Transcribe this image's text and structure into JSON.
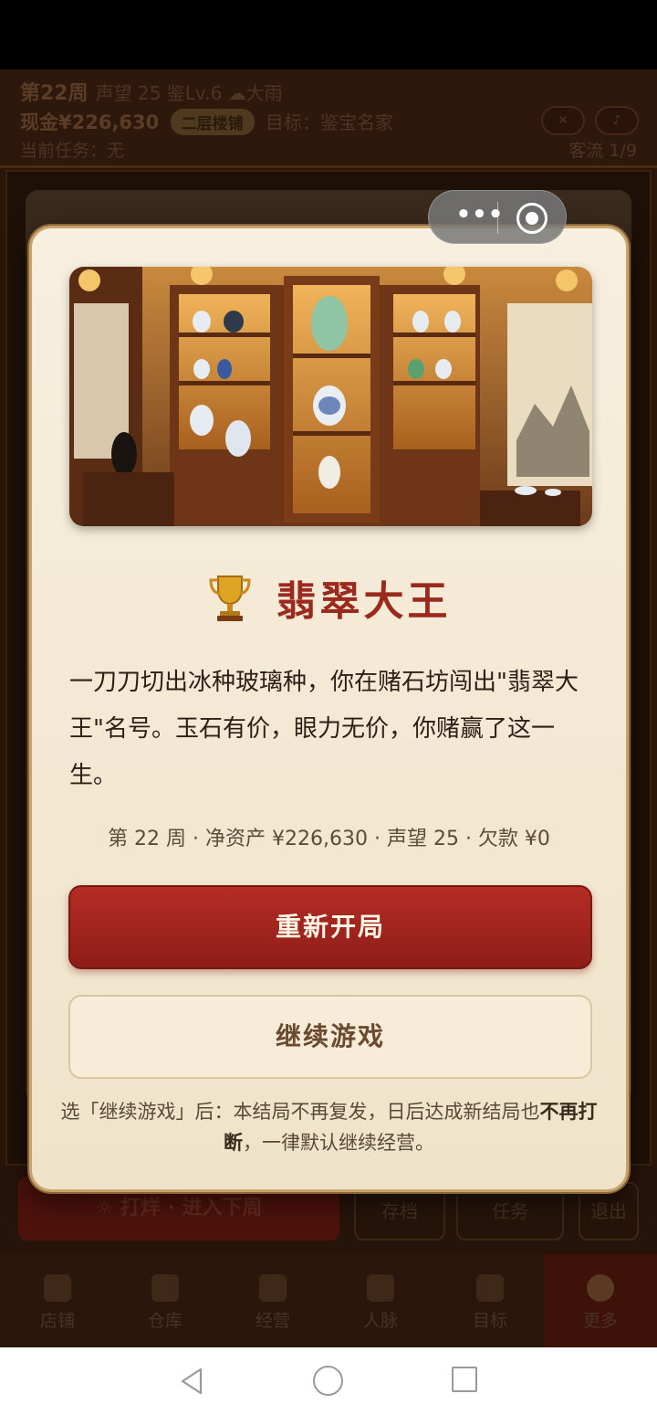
{
  "hud": {
    "week": "第22周",
    "stats": "声望 25 鉴Lv.6",
    "weather": "大雨",
    "cash": "现金¥226,630",
    "shop_badge": "二层楼铺",
    "goal": "目标：鉴宝名家",
    "task": "当前任务：无",
    "traffic": "客流 1/9"
  },
  "bottom_actions": {
    "next_week": "☼ 打烊 · 进入下周",
    "save": "存档",
    "tasks": "任务",
    "exit": "退出"
  },
  "tabs": [
    {
      "label": "店铺",
      "icon": "shop-icon"
    },
    {
      "label": "仓库",
      "icon": "warehouse-icon"
    },
    {
      "label": "经营",
      "icon": "business-icon"
    },
    {
      "label": "人脉",
      "icon": "people-icon"
    },
    {
      "label": "目标",
      "icon": "goal-icon"
    },
    {
      "label": "更多",
      "icon": "more-icon"
    }
  ],
  "capsule": {
    "more": "•••"
  },
  "modal": {
    "title": "翡翠大王",
    "description": "一刀刀切出冰种玻璃种，你在赌石坊闯出\"翡翠大王\"名号。玉石有价，眼力无价，你赌赢了这一生。",
    "stats": "第 22 周 · 净资产 ¥226,630 · 声望 25 · 欠款 ¥0",
    "restart_label": "重新开局",
    "continue_label": "继续游戏",
    "note_part1": "选「继续游戏」后：本结局不再复发，日后达成新结局也",
    "note_bold": "不再打断",
    "note_part2": "，一律默认继续经营。"
  },
  "colors": {
    "accent_red": "#9b2a1e",
    "button_red": "#a3261e",
    "modal_bg": "#f3e8d2",
    "gold_border": "#c8a46a"
  }
}
